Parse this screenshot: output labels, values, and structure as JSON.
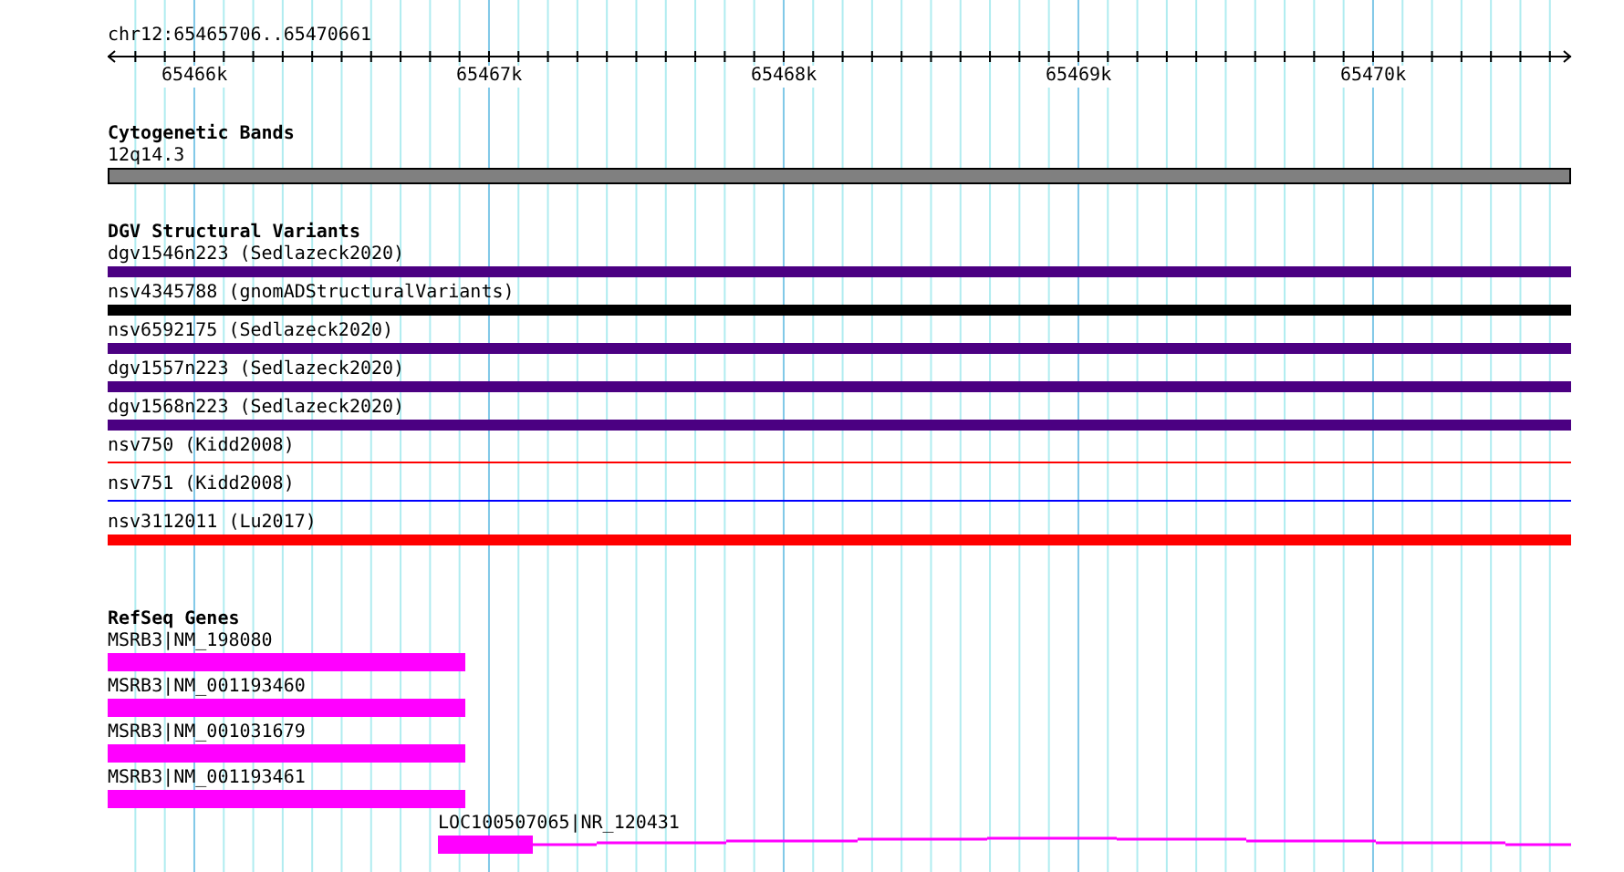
{
  "locus": "chr12:65465706..65470661",
  "ruler": {
    "ticks": [
      "65466k",
      "65467k",
      "65468k",
      "65469k",
      "65470k"
    ]
  },
  "tracks": [
    {
      "title": "Cytogenetic Bands",
      "kind": "cytoband",
      "features": [
        {
          "label": "12q14.3",
          "kind": "band"
        }
      ]
    },
    {
      "title": "DGV Structural Variants",
      "kind": "variants",
      "features": [
        {
          "label": "dgv1546n223 (Sedlazeck2020)",
          "kind": "thick",
          "color": "#4b0082"
        },
        {
          "label": "nsv4345788 (gnomADStructuralVariants)",
          "kind": "thick",
          "color": "#000000"
        },
        {
          "label": "nsv6592175 (Sedlazeck2020)",
          "kind": "thick",
          "color": "#4b0082"
        },
        {
          "label": "dgv1557n223 (Sedlazeck2020)",
          "kind": "thick",
          "color": "#4b0082"
        },
        {
          "label": "dgv1568n223 (Sedlazeck2020)",
          "kind": "thick",
          "color": "#4b0082"
        },
        {
          "label": "nsv750 (Kidd2008)",
          "kind": "thin",
          "color": "#ff0000"
        },
        {
          "label": "nsv751 (Kidd2008)",
          "kind": "thin",
          "color": "#0000ff"
        },
        {
          "label": "nsv3112011 (Lu2017)",
          "kind": "thick",
          "color": "#ff0000"
        }
      ]
    },
    {
      "title": "RefSeq Genes",
      "kind": "genes",
      "features": [
        {
          "label": "MSRB3|NM_198080",
          "kind": "partial"
        },
        {
          "label": "MSRB3|NM_001193460",
          "kind": "partial"
        },
        {
          "label": "MSRB3|NM_001031679",
          "kind": "partial"
        },
        {
          "label": "MSRB3|NM_001193461",
          "kind": "partial"
        },
        {
          "label": "LOC100507065|NR_120431",
          "kind": "transcript"
        }
      ]
    }
  ]
}
